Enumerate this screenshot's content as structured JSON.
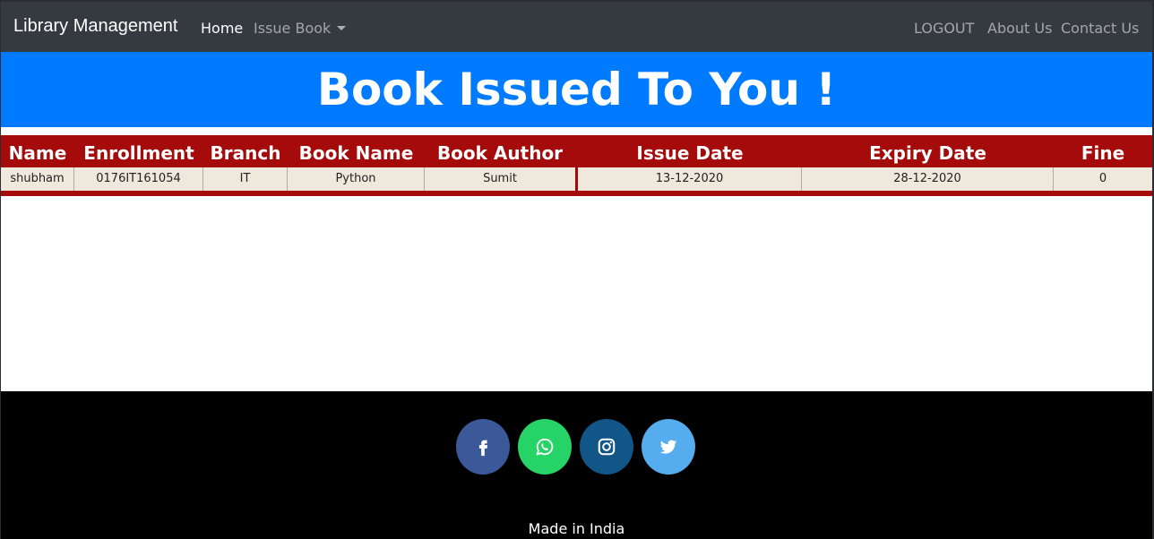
{
  "navbar": {
    "brand": "Library Management",
    "home": "Home",
    "issue_book": "Issue Book",
    "logout": "LOGOUT",
    "about": "About Us",
    "contact": "Contact Us"
  },
  "hero": {
    "title": "Book Issued To You !"
  },
  "table": {
    "headers": [
      "Name",
      "Enrollment",
      "Branch",
      "Book Name",
      "Book Author",
      "Issue Date",
      "Expiry Date",
      "Fine"
    ],
    "rows": [
      [
        "shubham",
        "0176IT161054",
        "IT",
        "Python",
        "Sumit",
        "13-12-2020",
        "28-12-2020",
        "0"
      ]
    ]
  },
  "footer": {
    "icons": [
      "facebook-icon",
      "whatsapp-icon",
      "instagram-icon",
      "twitter-icon"
    ],
    "made_in": "Made in India"
  },
  "colors": {
    "navbar": "#343a40",
    "hero": "#007bff",
    "table_header": "#a50b0b",
    "row_bg": "#efe8dd",
    "footer": "#000000",
    "facebook": "#3b5998",
    "whatsapp": "#25d366",
    "instagram": "#125688",
    "twitter": "#55acee"
  }
}
